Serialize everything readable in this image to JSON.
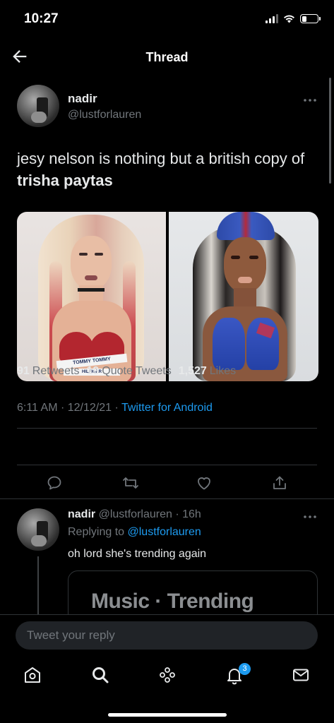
{
  "status_bar": {
    "time": "10:27",
    "battery_level": 0.3,
    "icons": [
      "signal-icon",
      "wifi-icon",
      "battery-icon"
    ]
  },
  "header": {
    "title": "Thread",
    "back_icon": "back-arrow-icon"
  },
  "main_tweet": {
    "name": "nadir",
    "handle": "@lustforlauren",
    "text_plain": "jesy nelson is nothing but a british copy of ",
    "text_bold": "trisha paytas",
    "timestamp": "6:11 AM · 12/12/21 · ",
    "source": "Twitter for Android",
    "stats": {
      "retweets_count": "91",
      "retweets_label": "Retweets",
      "quotes_count": "19",
      "quotes_label": "Quote Tweets",
      "likes_count": "1,527",
      "likes_label": "Likes"
    },
    "media_left_text": [
      "TOMMY",
      "TOMMY",
      "HILFIGER"
    ]
  },
  "reply_tweet": {
    "name": "nadir",
    "handle_time": "@lustforlauren · 16h",
    "replying_prefix": "Replying to ",
    "replying_handle": "@lustforlauren",
    "text": "oh lord she's trending again",
    "card_text": "Music · Trending"
  },
  "compose": {
    "placeholder": "Tweet your reply"
  },
  "tabbar": {
    "notification_badge": "3",
    "items": [
      "home-icon",
      "search-icon",
      "spaces-icon",
      "notifications-icon",
      "messages-icon"
    ]
  },
  "colors": {
    "background": "#000000",
    "accent": "#1d9bf0",
    "text": "#e7e9ea",
    "muted": "#71767b",
    "divider": "#2f3336"
  }
}
